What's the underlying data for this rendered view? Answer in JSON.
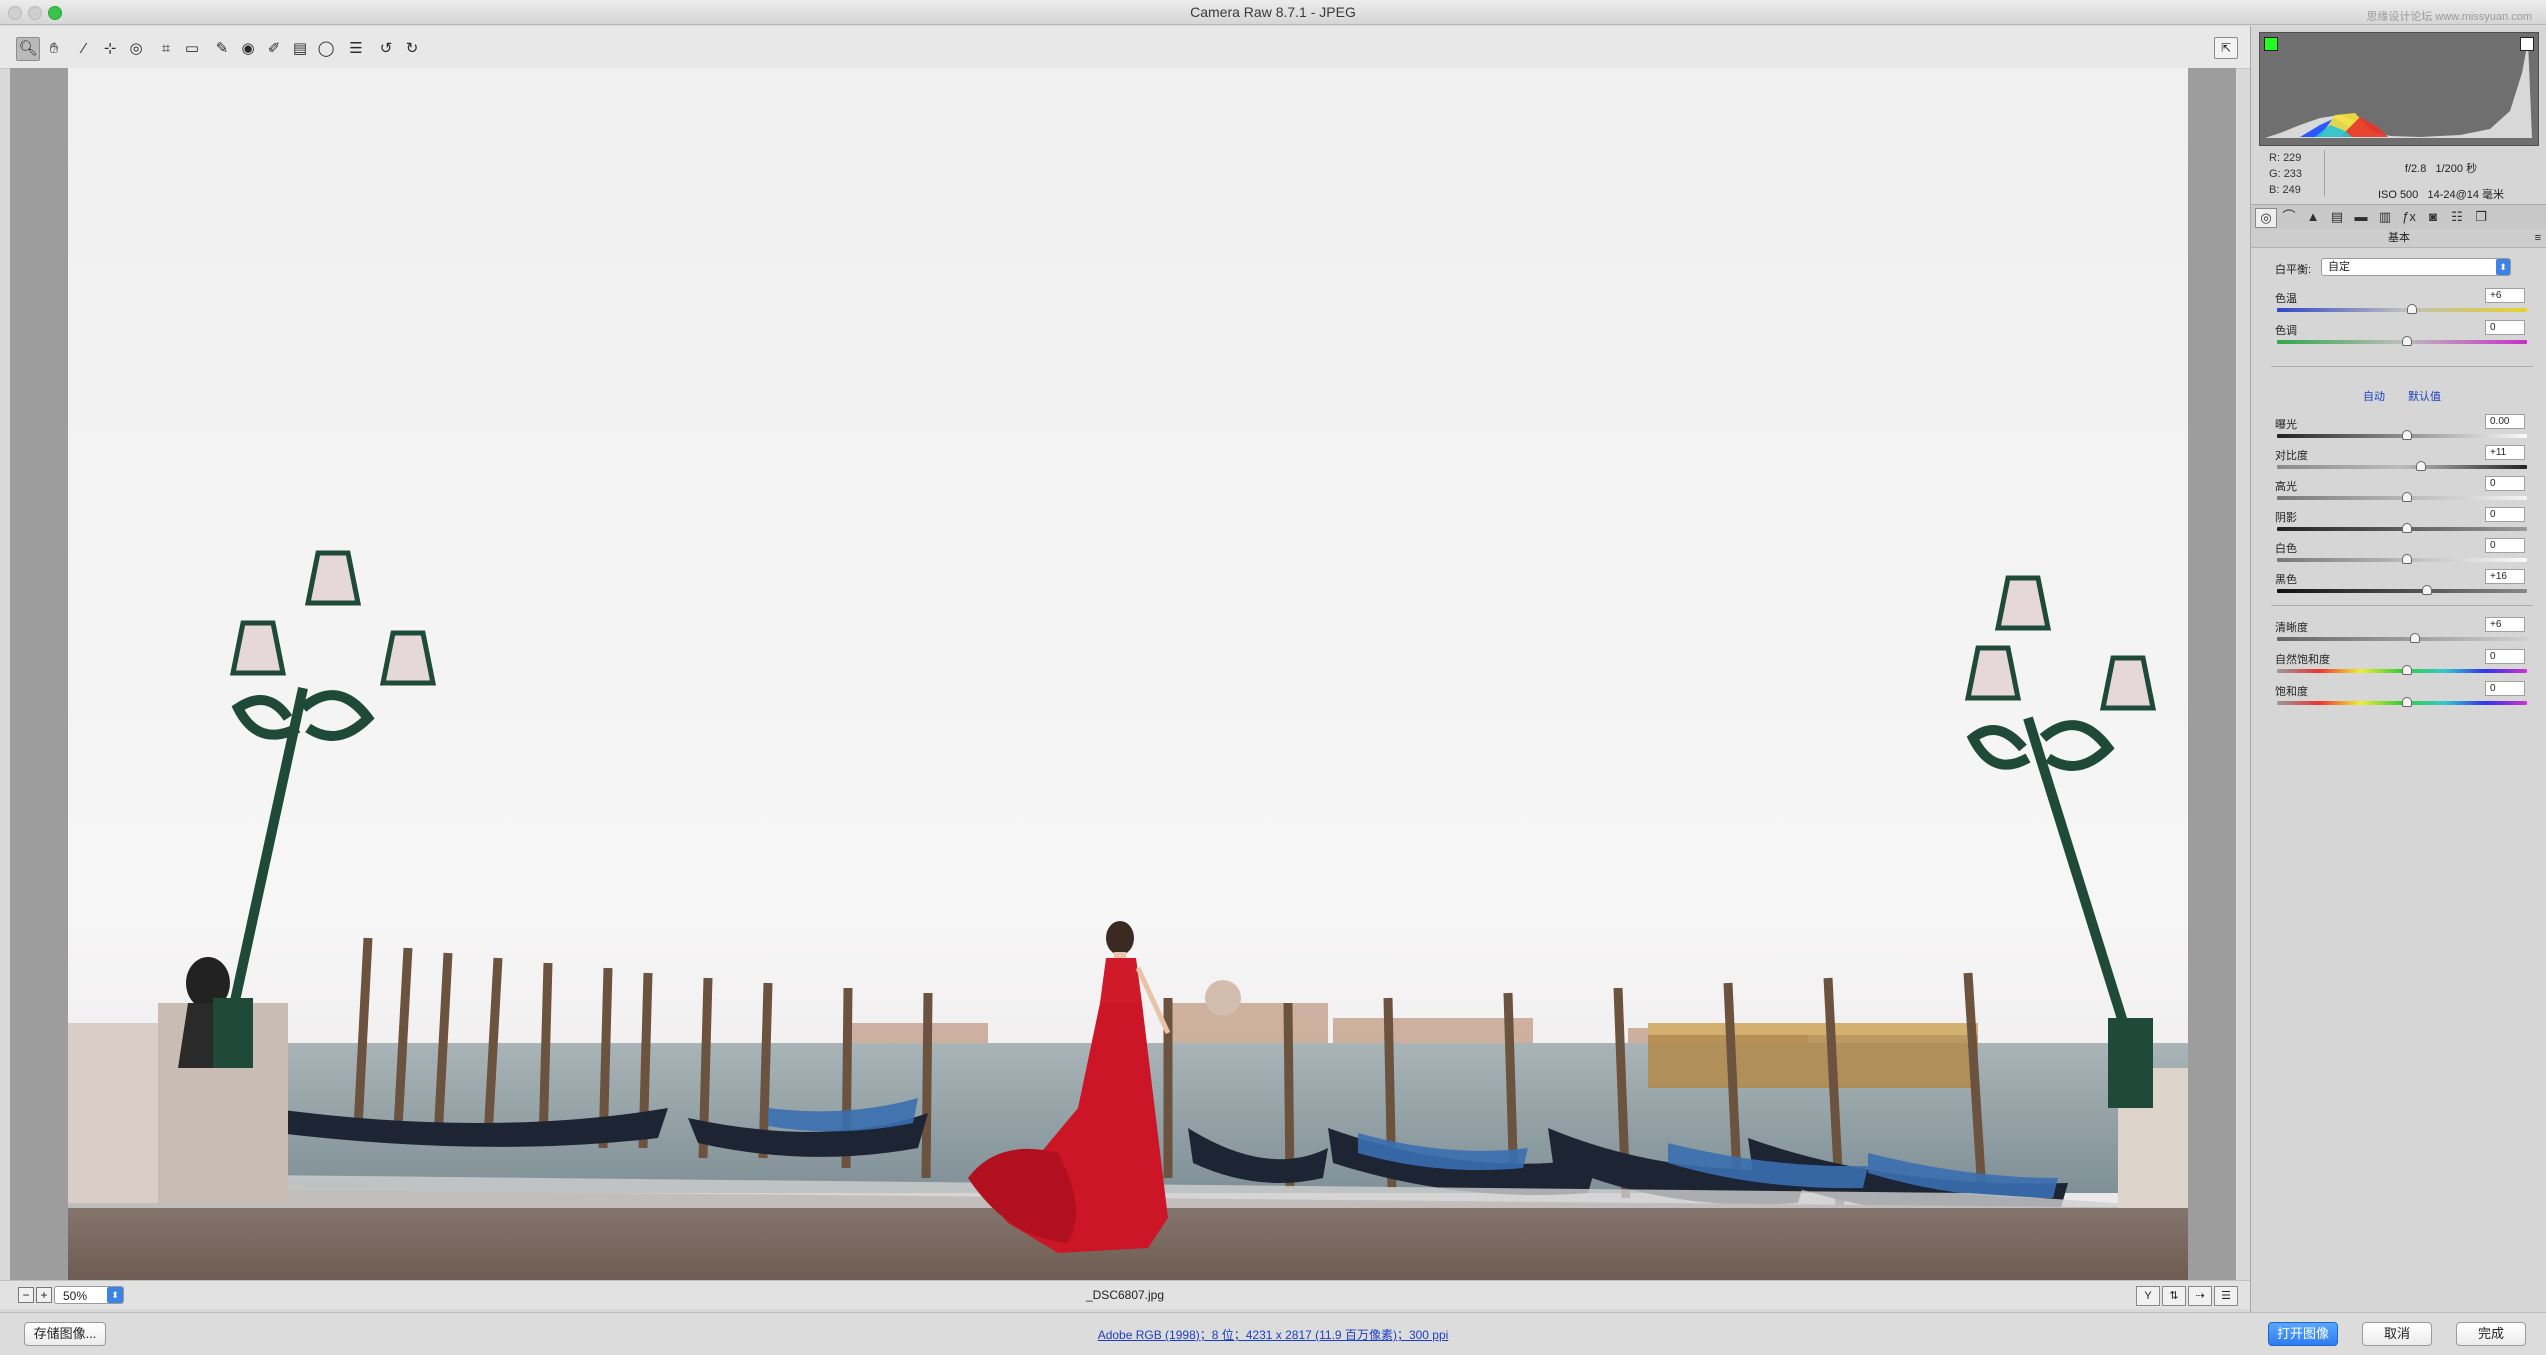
{
  "window": {
    "title": "Camera Raw 8.7.1 -  JPEG",
    "watermark": "思缘设计论坛  www.missyuan.com"
  },
  "toolbar": {
    "tools": [
      {
        "name": "zoom-tool",
        "icon": "magnifier-icon",
        "active": true
      },
      {
        "name": "hand-tool",
        "icon": "hand-icon"
      },
      {
        "name": "white-balance-tool",
        "icon": "eyedropper-icon"
      },
      {
        "name": "color-sampler-tool",
        "icon": "color-sampler-icon"
      },
      {
        "name": "targeted-adjustment-tool",
        "icon": "target-adjust-icon"
      },
      {
        "name": "crop-tool",
        "icon": "crop-icon"
      },
      {
        "name": "straighten-tool",
        "icon": "straighten-icon"
      },
      {
        "name": "spot-removal-tool",
        "icon": "spot-removal-icon"
      },
      {
        "name": "red-eye-tool",
        "icon": "red-eye-icon"
      },
      {
        "name": "adjustment-brush-tool",
        "icon": "brush-icon"
      },
      {
        "name": "graduated-filter-tool",
        "icon": "graduated-filter-icon"
      },
      {
        "name": "radial-filter-tool",
        "icon": "radial-filter-icon"
      },
      {
        "name": "preferences-button",
        "icon": "preferences-icon"
      },
      {
        "name": "rotate-ccw-button",
        "icon": "rotate-ccw-icon"
      },
      {
        "name": "rotate-cw-button",
        "icon": "rotate-cw-icon"
      }
    ]
  },
  "status": {
    "zoom_value": "50%",
    "filename": "_DSC6807.jpg"
  },
  "histogram": {
    "r_label": "R:",
    "r_value": "229",
    "g_label": "G:",
    "g_value": "233",
    "b_label": "B:",
    "b_value": "249",
    "aperture": "f/2.8",
    "shutter": "1/200 秒",
    "iso": "ISO 500",
    "lens": "14-24@14 毫米"
  },
  "panel": {
    "section_title": "基本",
    "white_balance_label": "白平衡:",
    "white_balance_value": "自定",
    "auto_label": "自动",
    "default_label": "默认值",
    "adjustments": [
      {
        "label": "色温",
        "value": "+6",
        "level": 0.52
      },
      {
        "label": "色调",
        "value": "0",
        "level": 0.5
      },
      {
        "label": "曝光",
        "value": "0.00",
        "level": 0.5
      },
      {
        "label": "对比度",
        "value": "+11",
        "level": 0.555
      },
      {
        "label": "高光",
        "value": "0",
        "level": 0.5
      },
      {
        "label": "阴影",
        "value": "0",
        "level": 0.5
      },
      {
        "label": "白色",
        "value": "0",
        "level": 0.5
      },
      {
        "label": "黑色",
        "value": "+16",
        "level": 0.58
      },
      {
        "label": "清晰度",
        "value": "+6",
        "level": 0.53
      },
      {
        "label": "自然饱和度",
        "value": "0",
        "level": 0.5
      },
      {
        "label": "饱和度",
        "value": "0",
        "level": 0.5
      }
    ]
  },
  "bottom": {
    "save_label": "存储图像...",
    "info_link": "Adobe RGB (1998)；8 位；4231 x 2817 (11.9 百万像素)；300 ppi",
    "open_label": "打开图像",
    "cancel_label": "取消",
    "done_label": "完成"
  },
  "colors": {
    "accent": "#2c7cf0",
    "dress": "#d01a2a",
    "water": "#8ea3ad",
    "sky": "#f2f2f2"
  }
}
